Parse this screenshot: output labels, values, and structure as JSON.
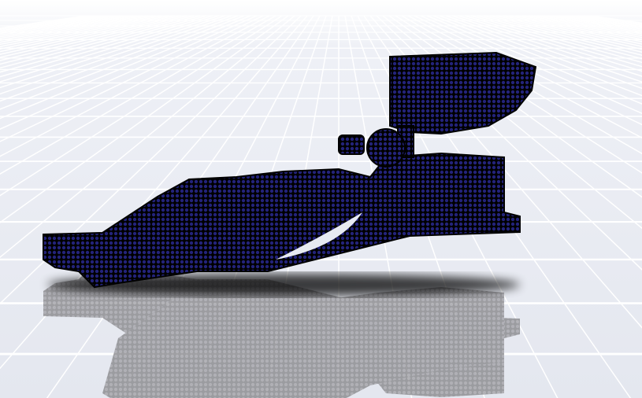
{
  "viewport": {
    "colors": {
      "background": "#e7eaf1",
      "grid_line": "#ffffff",
      "mesh_fill": "#1b1b6b",
      "mesh_edge": "#000000",
      "reflection": "#9c9c9f"
    }
  }
}
